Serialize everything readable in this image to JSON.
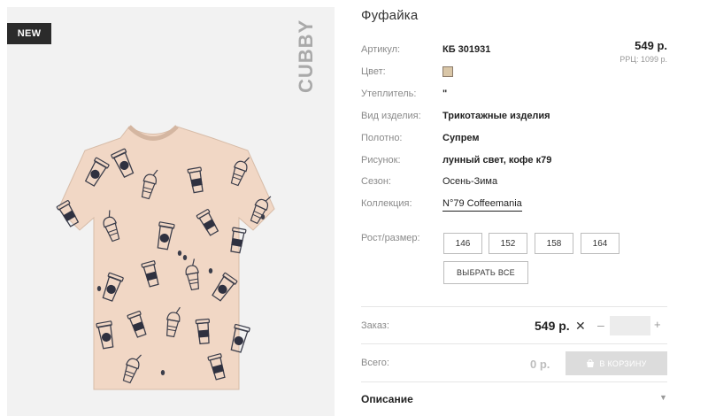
{
  "image": {
    "badge": "NEW",
    "brand": "CUBBY",
    "product_image_icon": "tshirt-coffee-print",
    "tshirt_color": "#f1d7c5",
    "print_color": "#2f3140"
  },
  "product": {
    "title": "Фуфайка",
    "price": "549 р.",
    "rrp": "РРЦ: 1099 р.",
    "swatch_color": "#d9c6a7",
    "specs": [
      {
        "label": "Артикул:",
        "value": "КБ 301931"
      },
      {
        "label": "Цвет:",
        "value": ""
      },
      {
        "label": "Утеплитель:",
        "value": "\""
      },
      {
        "label": "Вид изделия:",
        "value": "Трикотажные изделия"
      },
      {
        "label": "Полотно:",
        "value": "Супрем"
      },
      {
        "label": "Рисунок:",
        "value": "лунный свет, кофе к79"
      },
      {
        "label": "Сезон:",
        "value": "Осень-Зима"
      },
      {
        "label": "Коллекция:",
        "value": "N°79 Coffeemania"
      }
    ]
  },
  "sizes": {
    "label": "Рост/размер:",
    "options": [
      "146",
      "152",
      "158",
      "164"
    ],
    "select_all": "ВЫБРАТЬ ВСЕ"
  },
  "order": {
    "label": "Заказ:",
    "price": "549 р.",
    "multiply_icon": "close-x",
    "quantity": "",
    "minus": "–",
    "plus": "+"
  },
  "total": {
    "label": "Всего:",
    "value": "0 р.",
    "cart_button": "В КОРЗИНУ",
    "cart_icon": "basket-icon"
  },
  "description": {
    "label": "Описание",
    "chevron_icon": "chevron-down-icon"
  }
}
